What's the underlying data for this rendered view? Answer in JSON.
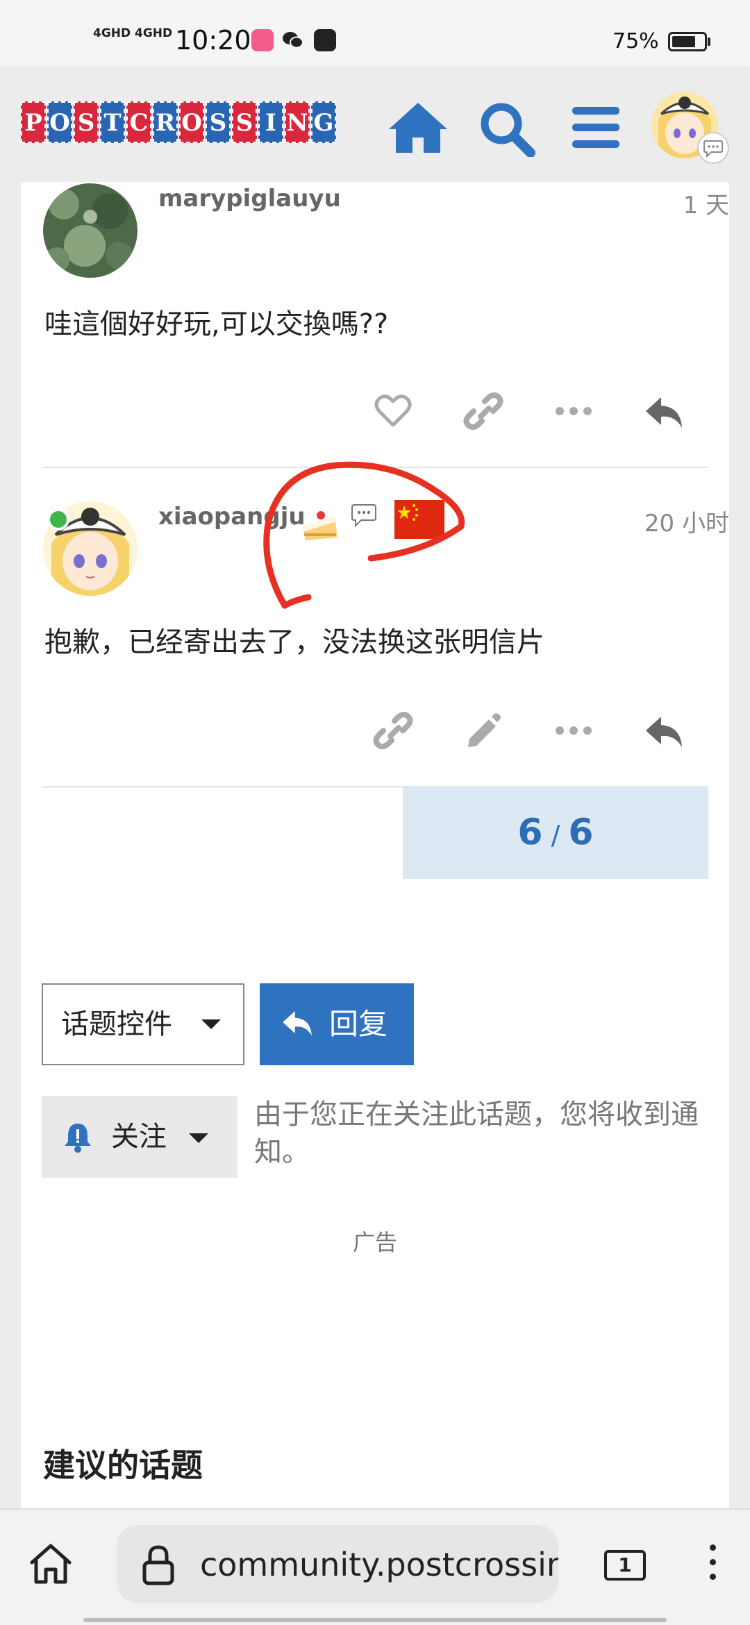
{
  "status_bar": {
    "signal1": "4GHD",
    "signal2": "4GHD",
    "time": "10:20",
    "battery": "75%",
    "battery_level": 0.75
  },
  "header": {
    "logo_letters": [
      "P",
      "O",
      "S",
      "T",
      "C",
      "R",
      "O",
      "S",
      "S",
      "I",
      "N",
      "G"
    ],
    "home_icon": "home-icon",
    "search_icon": "search-icon",
    "menu_icon": "hamburger-menu-icon",
    "chat_badge_icon": "chat-bubble-icon"
  },
  "posts": [
    {
      "username": "marypiglauyu",
      "time": "1 天",
      "body": "哇這個好好玩,可以交換嗎??",
      "actions": [
        "heart-icon",
        "link-icon",
        "more-icon",
        "reply-icon"
      ]
    },
    {
      "username": "xiaopangju",
      "time": "20 小时",
      "body": "抱歉，已经寄出去了，没法换这张明信片",
      "badges": [
        "cake-icon",
        "chat-bubble-icon",
        "china-flag-icon"
      ],
      "actions": [
        "link-icon",
        "edit-icon",
        "more-icon",
        "reply-icon"
      ]
    }
  ],
  "progress": {
    "current": "6",
    "total": "6"
  },
  "controls": {
    "topic_controls_label": "话题控件",
    "reply_label": "回复",
    "watch_label": "关注",
    "watch_note": "由于您正在关注此话题，您将收到通知。"
  },
  "ad_label": "广告",
  "suggested_title": "建议的话题",
  "browser": {
    "url": "community.postcrossing",
    "tab_count": "1"
  },
  "colors": {
    "brand_blue": "#2f72bf",
    "brand_red": "#d9283d",
    "annotation_red": "#e53022"
  }
}
